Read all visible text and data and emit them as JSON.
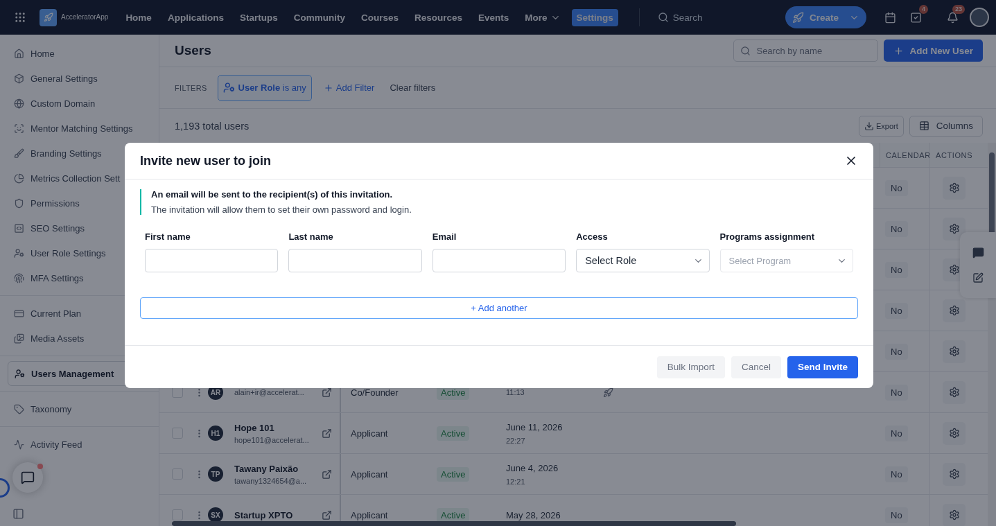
{
  "nav": {
    "app_name": "AcceleratorApp",
    "items": [
      {
        "label": "Home",
        "selected": false,
        "kind": "link"
      },
      {
        "label": "Applications",
        "selected": false,
        "kind": "link"
      },
      {
        "label": "Startups",
        "selected": false,
        "kind": "link"
      },
      {
        "label": "Community",
        "selected": false,
        "kind": "link"
      },
      {
        "label": "Courses",
        "selected": false,
        "kind": "link"
      },
      {
        "label": "Resources",
        "selected": false,
        "kind": "link"
      },
      {
        "label": "Events",
        "selected": false,
        "kind": "link"
      },
      {
        "label": "More",
        "selected": false,
        "kind": "menu"
      },
      {
        "label": "Settings",
        "selected": true,
        "kind": "link"
      }
    ],
    "search_placeholder": "Search",
    "create_label": "Create",
    "tasks_badge": "4",
    "notifications_badge": "23"
  },
  "sidebar": {
    "groups": [
      [
        {
          "label": "Home",
          "selected": false
        },
        {
          "label": "General Settings",
          "selected": false
        },
        {
          "label": "Custom Domain",
          "selected": false
        },
        {
          "label": "Mentor Matching Settings",
          "selected": false
        },
        {
          "label": "Branding Settings",
          "selected": false
        },
        {
          "label": "Metrics Collection Sett",
          "selected": false
        },
        {
          "label": "Permissions",
          "selected": false
        },
        {
          "label": "SEO Settings",
          "selected": false
        },
        {
          "label": "User Role Settings",
          "selected": false
        },
        {
          "label": "MFA Settings",
          "selected": false
        }
      ],
      [
        {
          "label": "Current Plan",
          "selected": false
        },
        {
          "label": "Media Assets",
          "selected": false
        }
      ],
      [
        {
          "label": "Users Management",
          "selected": true
        }
      ],
      [
        {
          "label": "Taxonomy",
          "selected": false
        }
      ],
      [
        {
          "label": "Activity Feed",
          "selected": false
        }
      ]
    ]
  },
  "page": {
    "title": "Users",
    "search_placeholder": "Search by name",
    "add_button": "Add New User",
    "filters_label": "FILTERS",
    "filter_chip": "**User Role** is any",
    "add_filter": "Add Filter",
    "clear_filters": "Clear filters",
    "total": "1,193 total users",
    "export_button": "Export",
    "columns_button": "Columns"
  },
  "table": {
    "columns": [
      {
        "label": "CALENDAR"
      },
      {
        "label": "ACTIONS"
      }
    ],
    "rows": [
      {
        "calendar": "No"
      },
      {
        "calendar": "No"
      },
      {
        "calendar": "No"
      },
      {
        "calendar": "No"
      },
      {
        "calendar": "No"
      },
      {
        "checked": false,
        "initials": "AR",
        "email": "alain+ir@accelerat...",
        "role": "Co/Founder",
        "status": "Active",
        "time": "11:13",
        "startup": true,
        "calendar": "No"
      },
      {
        "checked": false,
        "initials": "H1",
        "name": "Hope 101",
        "email": "hope101@accelerat...",
        "role": "Applicant",
        "status": "Active",
        "date": "June 11, 2026",
        "time": "22:27",
        "startup": false,
        "calendar": "No"
      },
      {
        "checked": false,
        "initials": "TP",
        "name": "Tawany Paixão",
        "email": "tawany1324654@a...",
        "role": "Applicant",
        "status": "Active",
        "date": "June 4, 2026",
        "time": "12:21",
        "startup": false,
        "calendar": "No"
      },
      {
        "checked": false,
        "initials": "SX",
        "name": "Startup XPTO",
        "role": "Applicant",
        "status": "Active",
        "date": "May 28, 2026",
        "startup": false,
        "calendar": "No"
      }
    ]
  },
  "modal": {
    "title": "Invite new user to join",
    "info_title": "An email will be sent to the recipient(s) of this invitation.",
    "info_text": "The invitation will allow them to set their own password and login.",
    "fields": [
      {
        "label": "First name",
        "kind": "text"
      },
      {
        "label": "Last name",
        "kind": "text"
      },
      {
        "label": "Email",
        "kind": "text"
      },
      {
        "label": "Access",
        "kind": "select",
        "value": "Select Role"
      },
      {
        "label": "Programs assignment",
        "kind": "select",
        "placeholder": "Select Program"
      }
    ],
    "add_another": "+ Add another",
    "buttons": [
      {
        "label": "Bulk Import",
        "kind": "secondary"
      },
      {
        "label": "Cancel",
        "kind": "secondary"
      },
      {
        "label": "Send Invite",
        "kind": "primary"
      }
    ]
  },
  "chat_widget": {
    "unread": true
  }
}
